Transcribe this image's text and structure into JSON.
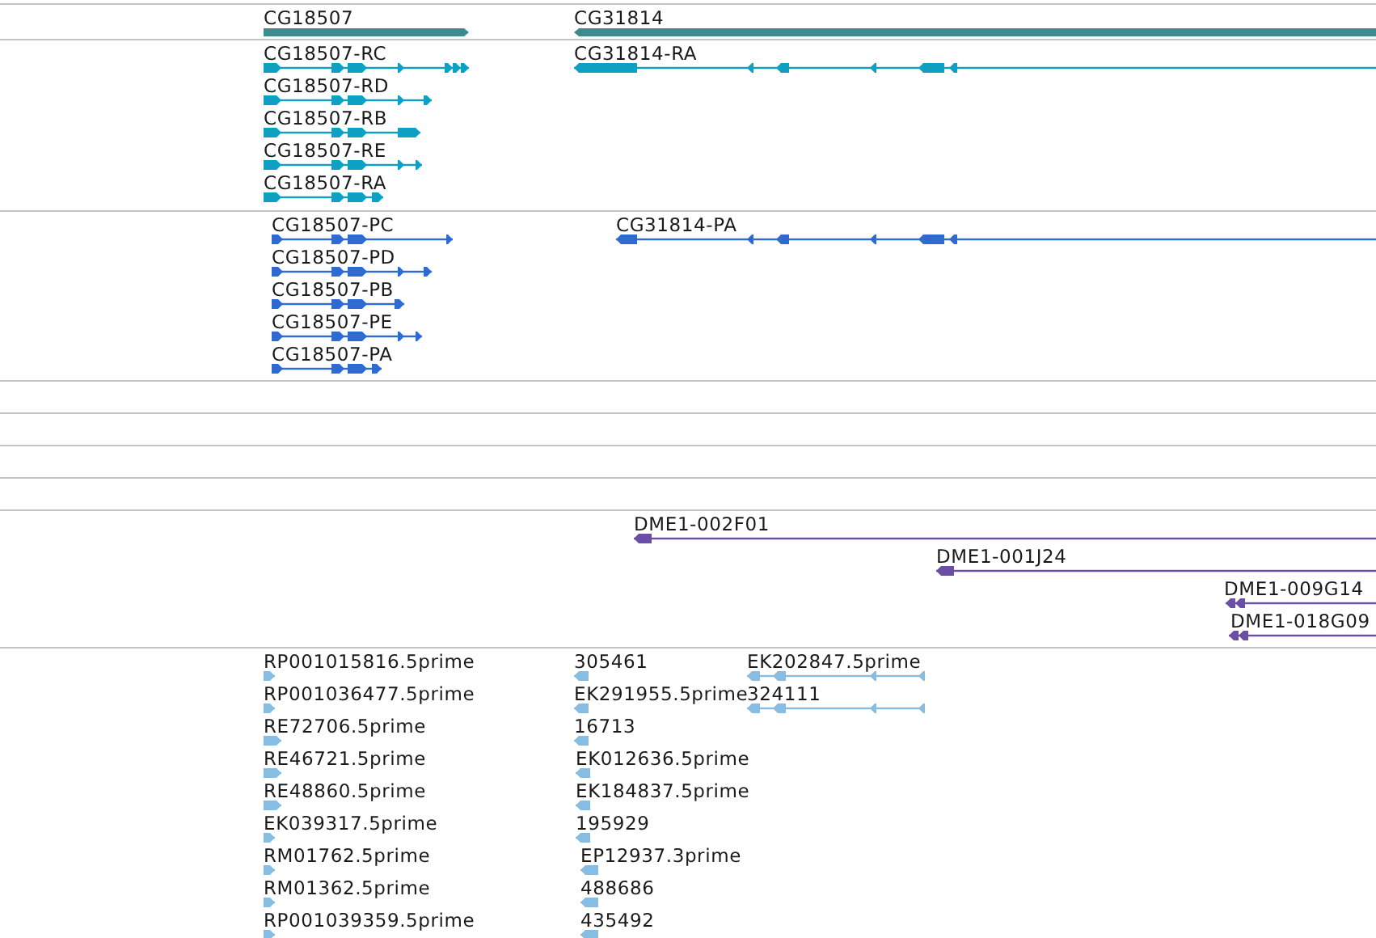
{
  "tracks": [
    {
      "kind": "features",
      "color": "#3d8b8f",
      "features": [
        {
          "label": "CG18507",
          "reverse": false
        },
        {
          "label": "CG31814",
          "reverse": true
        }
      ]
    },
    {
      "kind": "features",
      "color": "#0ea0c2",
      "features": [
        {
          "label": "CG18507-RC",
          "reverse": false
        },
        {
          "label": "CG31814-RA",
          "reverse": true
        },
        {
          "label": "CG18507-RD",
          "reverse": false
        },
        {
          "label": "CG18507-RB",
          "reverse": false
        },
        {
          "label": "CG18507-RE",
          "reverse": false
        },
        {
          "label": "CG18507-RA",
          "reverse": false
        }
      ]
    },
    {
      "kind": "features",
      "color": "#2f6ad0",
      "features": [
        {
          "label": "CG18507-PC",
          "reverse": false
        },
        {
          "label": "CG31814-PA",
          "reverse": true
        },
        {
          "label": "CG18507-PD",
          "reverse": false
        },
        {
          "label": "CG18507-PB",
          "reverse": false
        },
        {
          "label": "CG18507-PE",
          "reverse": false
        },
        {
          "label": "CG18507-PA",
          "reverse": false
        }
      ]
    },
    {
      "kind": "empty"
    },
    {
      "kind": "empty"
    },
    {
      "kind": "empty"
    },
    {
      "kind": "empty"
    },
    {
      "kind": "features",
      "color": "#6b4fa6",
      "features": [
        {
          "label": "DME1-002F01",
          "reverse": true
        },
        {
          "label": "DME1-001J24",
          "reverse": true
        },
        {
          "label": "DME1-009G14",
          "reverse": true
        },
        {
          "label": "DME1-018G09",
          "reverse": true
        }
      ]
    },
    {
      "kind": "features",
      "color": "#87bde2",
      "features": [
        {
          "label": "RP001015816.5prime",
          "reverse": false
        },
        {
          "label": "305461",
          "reverse": true
        },
        {
          "label": "EK202847.5prime",
          "reverse": true
        },
        {
          "label": "RP001036477.5prime",
          "reverse": false
        },
        {
          "label": "EK291955.5prime",
          "reverse": true
        },
        {
          "label": "324111",
          "reverse": true
        },
        {
          "label": "RE72706.5prime",
          "reverse": false
        },
        {
          "label": "16713",
          "reverse": true
        },
        {
          "label": "RE46721.5prime",
          "reverse": false
        },
        {
          "label": "EK012636.5prime",
          "reverse": true
        },
        {
          "label": "RE48860.5prime",
          "reverse": false
        },
        {
          "label": "EK184837.5prime",
          "reverse": true
        },
        {
          "label": "EK039317.5prime",
          "reverse": false
        },
        {
          "label": "195929",
          "reverse": true
        },
        {
          "label": "RM01762.5prime",
          "reverse": false
        },
        {
          "label": "EP12937.3prime",
          "reverse": true
        },
        {
          "label": "RM01362.5prime",
          "reverse": false
        },
        {
          "label": "488686",
          "reverse": true
        },
        {
          "label": "RP001039359.5prime",
          "reverse": false
        },
        {
          "label": "435492",
          "reverse": true
        }
      ]
    }
  ]
}
